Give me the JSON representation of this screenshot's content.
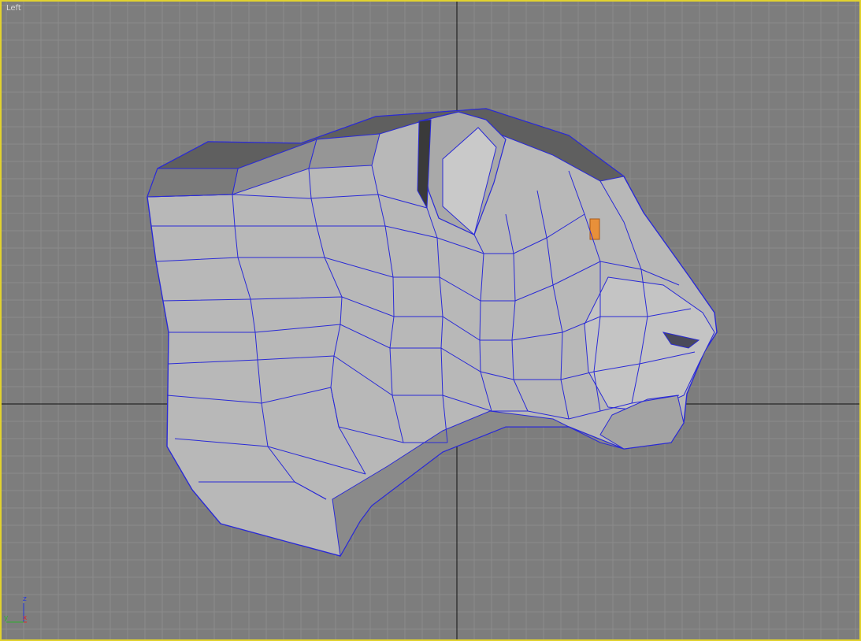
{
  "viewport": {
    "label": "Left",
    "active_border_color": "#e2d22e",
    "background_color": "#7d7d7d",
    "grid_color": "#8c8c8c",
    "home_grid_axis_color": "#111111"
  },
  "model": {
    "name": "wireframe-cat-head",
    "shaded_color": "#b9b9b9",
    "wire_color": "#2a2ad6",
    "selection_color": "#e8903a"
  },
  "axis_gizmo": {
    "z_label": "z",
    "y_label": "y",
    "x_label": "x",
    "z_color": "#2437e0",
    "y_color": "#2fb02f",
    "x_color": "#e02a2a"
  }
}
